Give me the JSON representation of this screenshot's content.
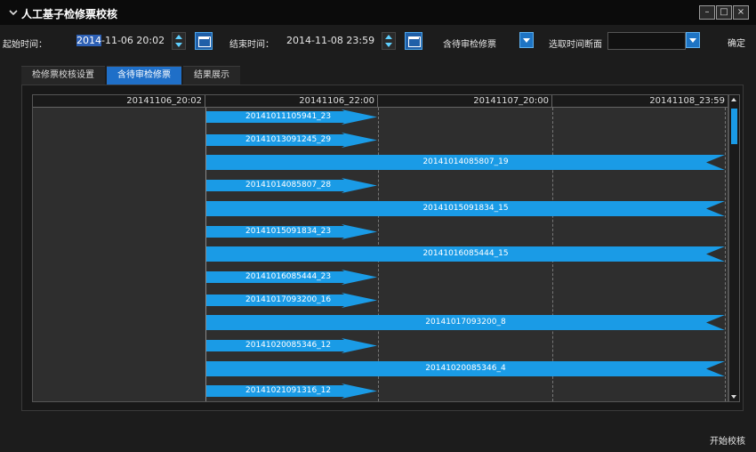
{
  "window": {
    "title": "人工基子检修票校核",
    "controls": [
      "–",
      "□",
      "×"
    ]
  },
  "toolbar": {
    "start_label": "起始时间：",
    "start_value_selected": "2014",
    "start_value_rest": "-11-06 20:02",
    "end_label": "结束时间：",
    "end_value": "2014-11-08 23:59",
    "filter_value": "含待审检修票",
    "section_label": "选取时间断面",
    "section_value": "",
    "confirm_label": "确定"
  },
  "tabs": [
    {
      "label": "检修票校核设置",
      "active": false
    },
    {
      "label": "含待审检修票",
      "active": true
    },
    {
      "label": "结果展示",
      "active": false
    }
  ],
  "gantt": {
    "headers": [
      "20141106_20:02",
      "20141106_22:00",
      "20141107_20:00",
      "20141108_23:59"
    ],
    "rows": [
      {
        "label": "20141011105941_23",
        "kind": "short"
      },
      {
        "label": "20141013091245_29",
        "kind": "short"
      },
      {
        "label": "20141014085807_19",
        "kind": "long"
      },
      {
        "label": "20141014085807_28",
        "kind": "short"
      },
      {
        "label": "20141015091834_15",
        "kind": "long"
      },
      {
        "label": "20141015091834_23",
        "kind": "short"
      },
      {
        "label": "20141016085444_15",
        "kind": "long"
      },
      {
        "label": "20141016085444_23",
        "kind": "short"
      },
      {
        "label": "20141017093200_16",
        "kind": "short"
      },
      {
        "label": "20141017093200_8",
        "kind": "long"
      },
      {
        "label": "20141020085346_12",
        "kind": "short"
      },
      {
        "label": "20141020085346_4",
        "kind": "long"
      },
      {
        "label": "20141021091316_12",
        "kind": "short"
      }
    ]
  },
  "footer": {
    "start_button": "开始校核"
  },
  "colors": {
    "bar": "#1a9be6",
    "tab_active": "#1f6fc8",
    "background": "#1c1c1c"
  }
}
